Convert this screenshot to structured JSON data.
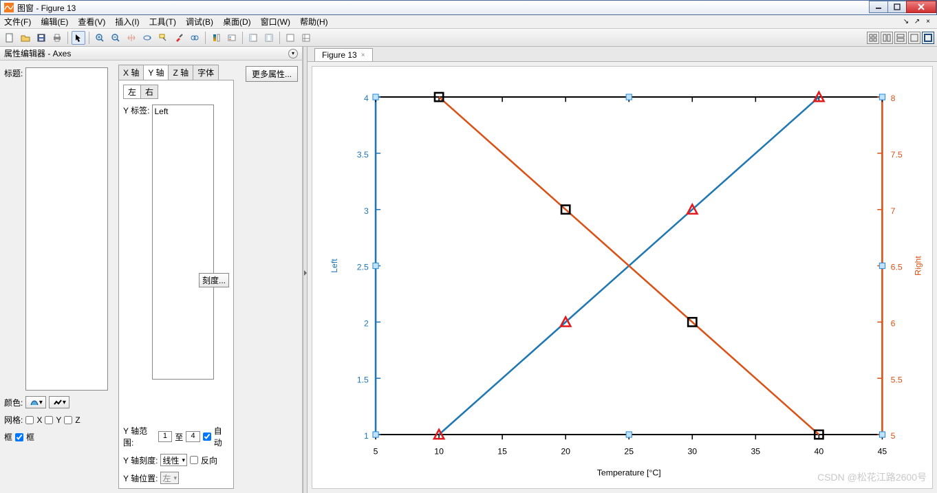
{
  "window": {
    "title": "图窗 - Figure 13"
  },
  "menu": {
    "file": "文件(F)",
    "edit": "编辑(E)",
    "view": "查看(V)",
    "insert": "插入(I)",
    "tools": "工具(T)",
    "debug": "调试(B)",
    "desktop": "桌面(D)",
    "window": "窗口(W)",
    "help": "帮助(H)"
  },
  "prop": {
    "header": "属性编辑器 - Axes",
    "title_label": "标题:",
    "more": "更多属性...",
    "tabs": {
      "x": "X 轴",
      "y": "Y 轴",
      "z": "Z 轴",
      "font": "字体"
    },
    "lr": {
      "left": "左",
      "right": "右"
    },
    "ylabel_label": "Y 标签:",
    "ylabel_value": "Left",
    "ticks_btn": "刻度...",
    "ylim_label": "Y 轴范围:",
    "ylim_to": "至",
    "ylim_lo": "1",
    "ylim_hi": "4",
    "auto": "自动",
    "yscale_label": "Y 轴刻度:",
    "yscale_value": "线性",
    "reverse": "反向",
    "ypos_label": "Y 轴位置:",
    "ypos_value": "左",
    "color_label": "颜色:",
    "grid_label": "网格:",
    "gridX": "X",
    "gridY": "Y",
    "gridZ": "Z",
    "frame_label": "框",
    "frame_chk": "框"
  },
  "figtab": {
    "label": "Figure 13"
  },
  "watermark": "CSDN @松花江路2600号",
  "chart_data": {
    "type": "line",
    "xlabel": "Temperature [°C]",
    "ylabel_left": "Left",
    "ylabel_right": "Right",
    "x_ticks": [
      5,
      10,
      15,
      20,
      25,
      30,
      35,
      40,
      45
    ],
    "yl_ticks": [
      1,
      1.5,
      2,
      2.5,
      3,
      3.5,
      4
    ],
    "yl_lim": [
      1,
      4
    ],
    "yr_ticks": [
      5,
      5.5,
      6,
      6.5,
      7,
      7.5,
      8
    ],
    "yr_lim": [
      5,
      8
    ],
    "x": [
      10,
      20,
      30,
      40
    ],
    "series": [
      {
        "name": "Left",
        "axis": "left",
        "color": "#1f77b4",
        "marker": "triangle-red",
        "values": [
          1,
          2,
          3,
          4
        ]
      },
      {
        "name": "Right",
        "axis": "right",
        "color": "#d95319",
        "marker": "square-black",
        "values": [
          8,
          7,
          6,
          5
        ]
      }
    ]
  }
}
